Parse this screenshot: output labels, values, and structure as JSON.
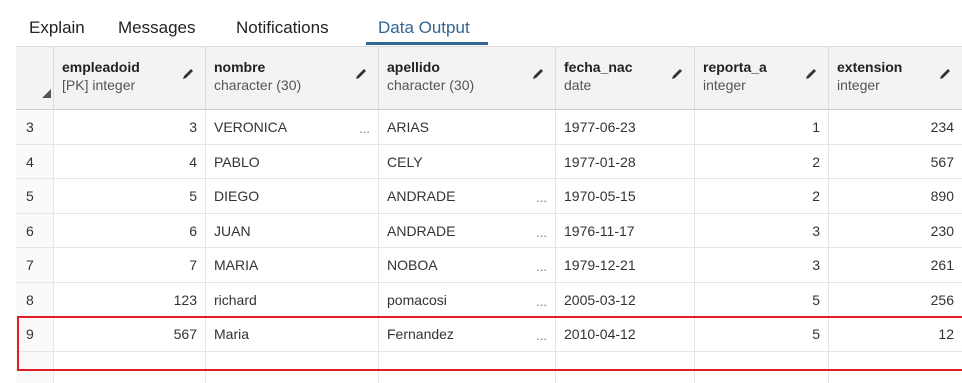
{
  "tabs": [
    {
      "label": "Explain"
    },
    {
      "label": "Messages"
    },
    {
      "label": "Notifications"
    },
    {
      "label": "Data Output"
    }
  ],
  "active_tab": "Data Output",
  "columns": [
    {
      "name": "empleadoid",
      "type": "[PK] integer"
    },
    {
      "name": "nombre",
      "type": "character (30)"
    },
    {
      "name": "apellido",
      "type": "character (30)"
    },
    {
      "name": "fecha_nac",
      "type": "date"
    },
    {
      "name": "reporta_a",
      "type": "integer"
    },
    {
      "name": "extension",
      "type": "integer"
    }
  ],
  "rows": [
    {
      "rownum": "3",
      "empleadoid": "3",
      "nombre": "VERONICA",
      "nombre_ellipsis": "...",
      "apellido": "ARIAS",
      "apellido_ellipsis": "",
      "fecha_nac": "1977-06-23",
      "reporta_a": "1",
      "extension": "234"
    },
    {
      "rownum": "4",
      "empleadoid": "4",
      "nombre": "PABLO",
      "nombre_ellipsis": "",
      "apellido": "CELY",
      "apellido_ellipsis": "",
      "fecha_nac": "1977-01-28",
      "reporta_a": "2",
      "extension": "567"
    },
    {
      "rownum": "5",
      "empleadoid": "5",
      "nombre": "DIEGO",
      "nombre_ellipsis": "",
      "apellido": "ANDRADE",
      "apellido_ellipsis": "...",
      "fecha_nac": "1970-05-15",
      "reporta_a": "2",
      "extension": "890"
    },
    {
      "rownum": "6",
      "empleadoid": "6",
      "nombre": "JUAN",
      "nombre_ellipsis": "",
      "apellido": "ANDRADE",
      "apellido_ellipsis": "...",
      "fecha_nac": "1976-11-17",
      "reporta_a": "3",
      "extension": "230"
    },
    {
      "rownum": "7",
      "empleadoid": "7",
      "nombre": "MARIA",
      "nombre_ellipsis": "",
      "apellido": "NOBOA",
      "apellido_ellipsis": "...",
      "fecha_nac": "1979-12-21",
      "reporta_a": "3",
      "extension": "261"
    },
    {
      "rownum": "8",
      "empleadoid": "123",
      "nombre": "richard",
      "nombre_ellipsis": "",
      "apellido": "pomacosi",
      "apellido_ellipsis": "...",
      "fecha_nac": "2005-03-12",
      "reporta_a": "5",
      "extension": "256"
    },
    {
      "rownum": "9",
      "empleadoid": "567",
      "nombre": "Maria",
      "nombre_ellipsis": "",
      "apellido": "Fernandez",
      "apellido_ellipsis": "...",
      "fecha_nac": "2010-04-12",
      "reporta_a": "5",
      "extension": "12"
    },
    {
      "rownum": "",
      "empleadoid": "",
      "nombre": "",
      "nombre_ellipsis": "",
      "apellido": "",
      "apellido_ellipsis": "",
      "fecha_nac": "",
      "reporta_a": "",
      "extension": ""
    }
  ],
  "colors": {
    "active_tab": "#326690",
    "highlight": "#e41c23"
  }
}
